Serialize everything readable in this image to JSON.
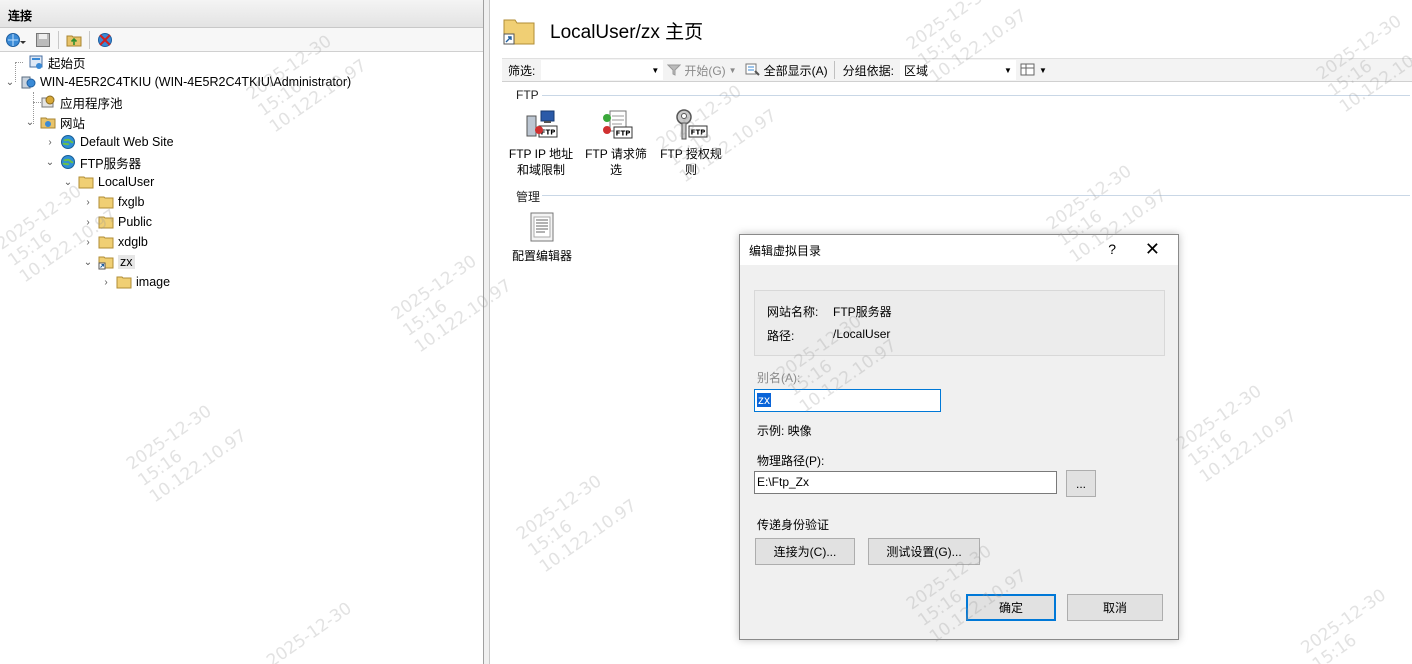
{
  "connections": {
    "title": "连接",
    "tree": [
      {
        "label": "起始页",
        "icon": "start-page-icon"
      },
      {
        "label": "WIN-4E5R2C4TKIU (WIN-4E5R2C4TKIU\\Administrator)",
        "icon": "server-icon"
      },
      {
        "label": "应用程序池",
        "icon": "app-pool-icon"
      },
      {
        "label": "网站",
        "icon": "sites-folder-icon"
      },
      {
        "label": "Default Web Site",
        "icon": "globe-icon"
      },
      {
        "label": "FTP服务器",
        "icon": "globe-icon"
      },
      {
        "label": "LocalUser",
        "icon": "folder-icon"
      },
      {
        "label": "fxglb",
        "icon": "folder-icon"
      },
      {
        "label": "Public",
        "icon": "folder-icon"
      },
      {
        "label": "xdglb",
        "icon": "folder-icon"
      },
      {
        "label": "zx",
        "icon": "virtual-dir-icon"
      },
      {
        "label": "image",
        "icon": "folder-icon"
      }
    ]
  },
  "main": {
    "title": "LocalUser/zx 主页",
    "filter_bar": {
      "filter_label": "筛选:",
      "start_label": "开始(G)",
      "show_all_label": "全部显示(A)",
      "group_by_label": "分组依据:",
      "group_by_value": "区域"
    },
    "sections": [
      {
        "label": "FTP"
      },
      {
        "label": "管理"
      }
    ],
    "features": {
      "ftp_ip": {
        "line1": "FTP IP 地址",
        "line2": "和域限制"
      },
      "ftp_request": {
        "line1": "FTP 请求筛",
        "line2": "选"
      },
      "ftp_auth": {
        "line1": "FTP 授权规",
        "line2": "则"
      },
      "config_editor": {
        "line1": "配置编辑器"
      }
    }
  },
  "dialog": {
    "title": "编辑虚拟目录",
    "help": "?",
    "close": "✕",
    "site_name_key": "网站名称:",
    "site_name_value": "FTP服务器",
    "path_key": "路径:",
    "path_value": "/LocalUser",
    "alias_label": "别名(A):",
    "alias_value": "zx",
    "example": "示例: 映像",
    "physical_path_label": "物理路径(P):",
    "physical_path_value": "E:\\Ftp_Zx",
    "browse_label": "...",
    "pass_auth_label": "传递身份验证",
    "connect_as_label": "连接为(C)...",
    "test_settings_label": "测试设置(G)...",
    "ok_label": "确定",
    "cancel_label": "取消"
  },
  "watermark": {
    "date": "2025-12-30",
    "time": "15:16",
    "ip": "10.122.10.97"
  }
}
